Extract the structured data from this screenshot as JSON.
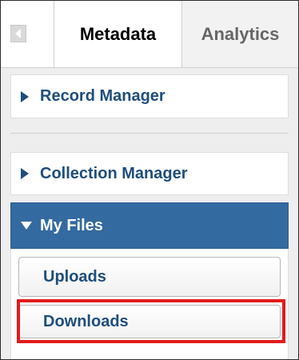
{
  "tabs": [
    {
      "label": "Metadata",
      "active": true
    },
    {
      "label": "Analytics",
      "active": false
    }
  ],
  "collapse_icon": "collapse-left-icon",
  "sections": {
    "record_manager": {
      "label": "Record Manager",
      "icon": "caret-right-icon"
    },
    "collection_manager": {
      "label": "Collection Manager",
      "icon": "caret-right-icon"
    },
    "my_files": {
      "label": "My Files",
      "icon": "caret-down-icon",
      "expanded": true
    }
  },
  "my_files_items": {
    "uploads": "Uploads",
    "downloads": "Downloads"
  },
  "colors": {
    "accent_blue": "#336aa0",
    "link_text": "#1e4e7c",
    "highlight_red": "#e31b1b"
  }
}
